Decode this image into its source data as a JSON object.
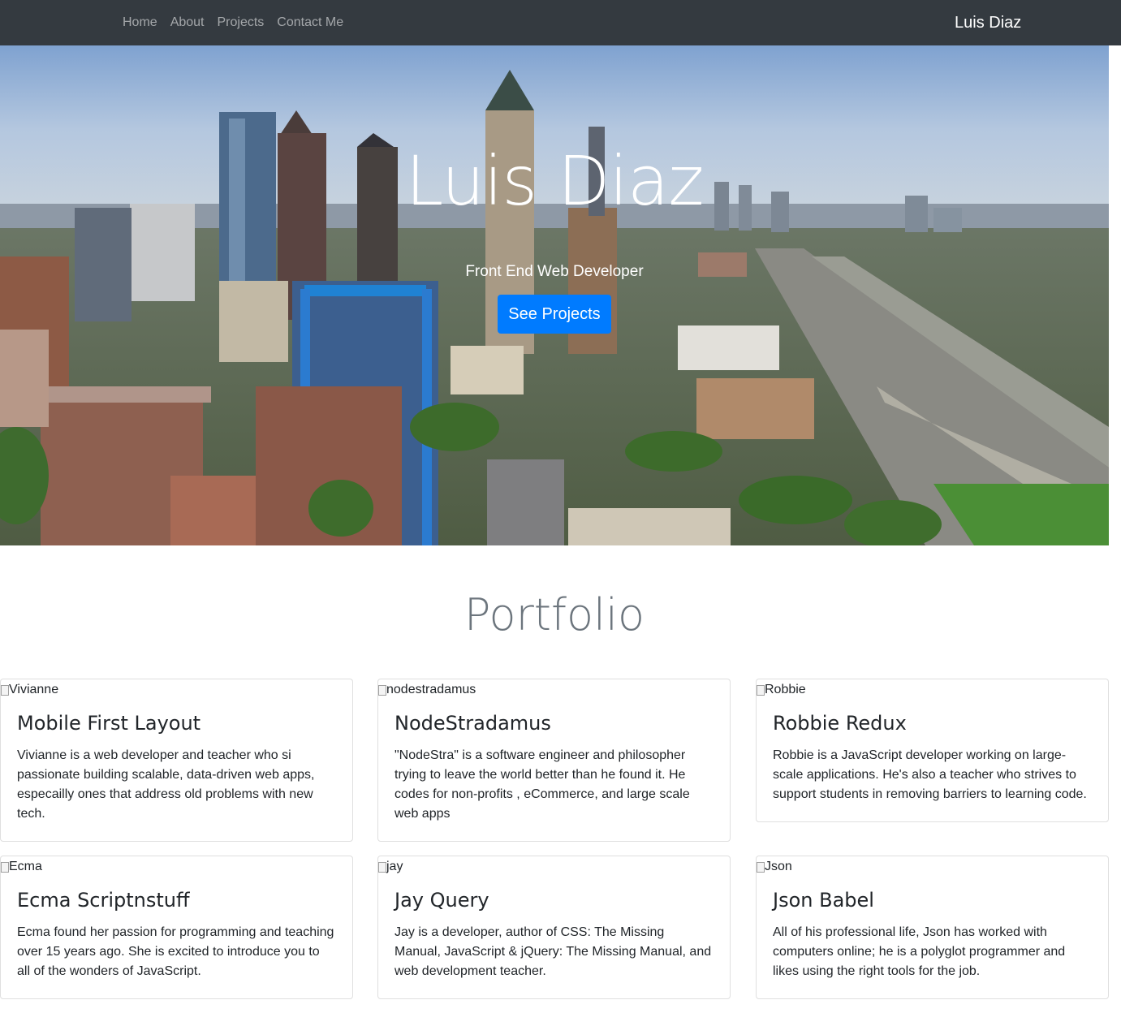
{
  "navbar": {
    "links": [
      "Home",
      "About",
      "Projects",
      "Contact Me"
    ],
    "brand": "Luis Diaz"
  },
  "hero": {
    "title": "Luis Diaz",
    "subtitle": "Front End Web Developer",
    "button": "See Projects"
  },
  "portfolio": {
    "title": "Portfolio",
    "cards": [
      {
        "img_alt": "Vivianne",
        "title": "Mobile First Layout",
        "text": "Vivianne is a web developer and teacher who si passionate building scalable, data-driven web apps, especailly ones that address old problems with new tech."
      },
      {
        "img_alt": "nodestradamus",
        "title": "NodeStradamus",
        "text": "\"NodeStra\" is a software engineer and philosopher trying to leave the world better than he found it. He codes for non-profits , eCommerce, and large scale web apps"
      },
      {
        "img_alt": "Robbie",
        "title": "Robbie Redux",
        "text": "Robbie is a JavaScript developer working on large-scale applications. He's also a teacher who strives to support students in removing barriers to learning code."
      },
      {
        "img_alt": "Ecma",
        "title": "Ecma Scriptnstuff",
        "text": "Ecma found her passion for programming and teaching over 15 years ago. She is excited to introduce you to all of the wonders of JavaScript."
      },
      {
        "img_alt": "jay",
        "title": "Jay Query",
        "text": "Jay is a developer, author of CSS: The Missing Manual, JavaScript & jQuery: The Missing Manual, and web development teacher."
      },
      {
        "img_alt": "Json",
        "title": "Json Babel",
        "text": "All of his professional life, Json has worked with computers online; he is a polyglot programmer and likes using the right tools for the job."
      }
    ]
  },
  "colors": {
    "navbar_bg": "#343a40",
    "primary": "#007bff",
    "muted": "#6c757d"
  }
}
